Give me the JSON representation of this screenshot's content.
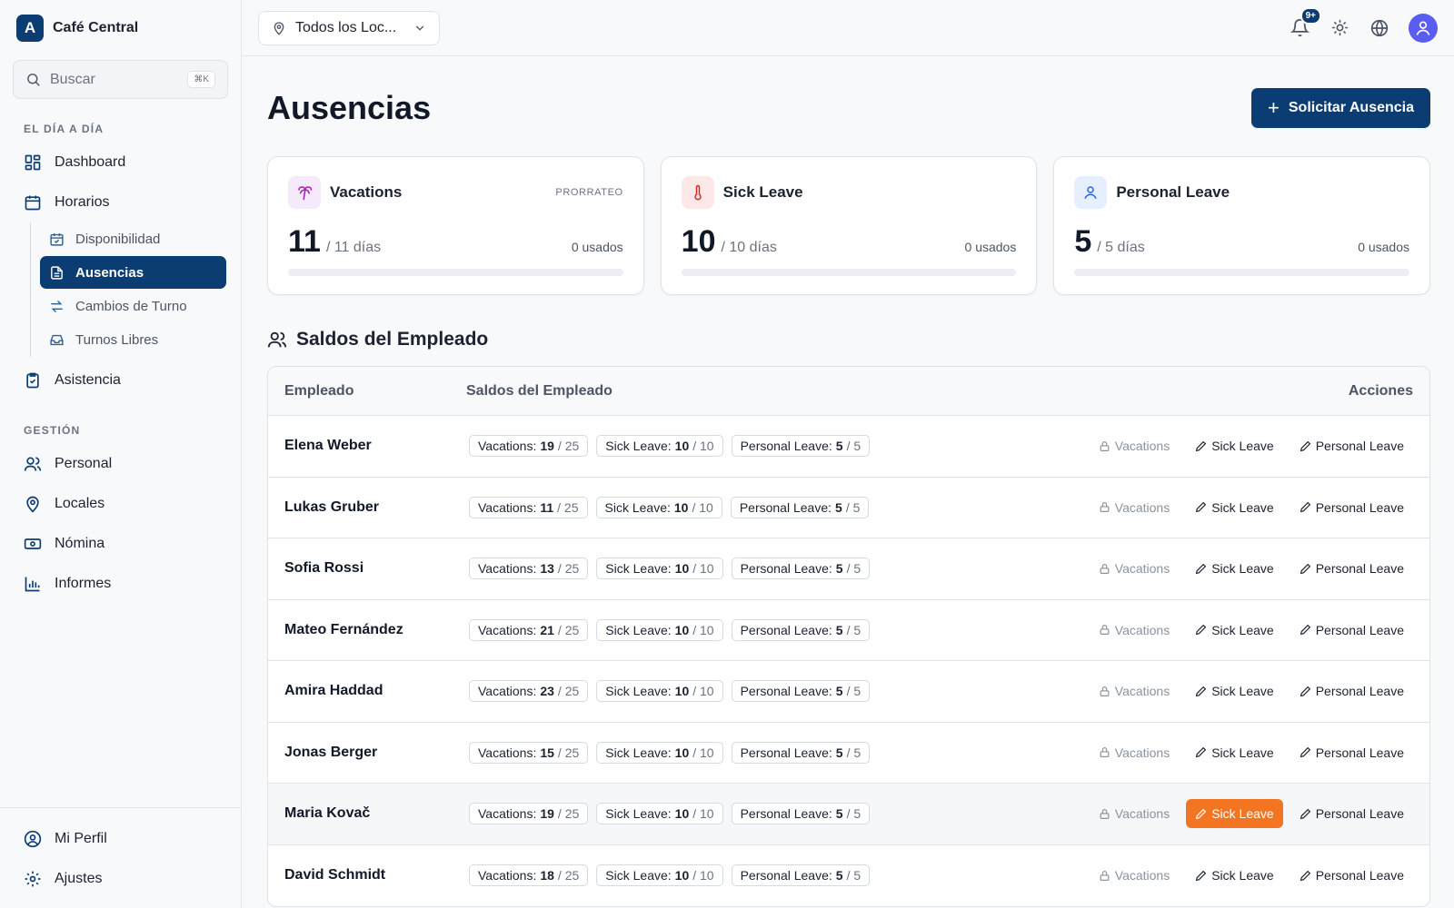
{
  "brand": {
    "initial": "A",
    "name": "Café Central"
  },
  "search": {
    "placeholder": "Buscar",
    "shortcut": "⌘K"
  },
  "sidebar": {
    "section1": "EL DÍA A DÍA",
    "dashboard": "Dashboard",
    "horarios": "Horarios",
    "sub": [
      "Disponibilidad",
      "Ausencias",
      "Cambios de Turno",
      "Turnos Libres"
    ],
    "asistencia": "Asistencia",
    "section2": "GESTIÓN",
    "gestion": [
      "Personal",
      "Locales",
      "Nómina",
      "Informes"
    ],
    "bottom": [
      "Mi Perfil",
      "Ajustes"
    ]
  },
  "topbar": {
    "location": "Todos los Loc...",
    "notif_badge": "9+"
  },
  "page": {
    "title": "Ausencias",
    "request_button": "Solicitar Ausencia"
  },
  "cards": [
    {
      "title": "Vacations",
      "tag": "PRORRATEO",
      "value": "11",
      "total": "/ 11 días",
      "used": "0 usados",
      "used_fraction": 0
    },
    {
      "title": "Sick Leave",
      "tag": "",
      "value": "10",
      "total": "/ 10 días",
      "used": "0 usados",
      "used_fraction": 0
    },
    {
      "title": "Personal Leave",
      "tag": "",
      "value": "5",
      "total": "/ 5 días",
      "used": "0 usados",
      "used_fraction": 0
    }
  ],
  "balances": {
    "title": "Saldos del Empleado",
    "headers": {
      "employee": "Empleado",
      "balances": "Saldos del Empleado",
      "actions": "Acciones"
    },
    "labels": {
      "vac": "Vacations:",
      "sick": "Sick Leave:",
      "pers": "Personal Leave:"
    },
    "actions": {
      "vac": "Vacations",
      "sick": "Sick Leave",
      "pers": "Personal Leave"
    },
    "rows": [
      {
        "name": "Elena Weber",
        "vac": "19",
        "vac_total": "/ 25",
        "sick": "10",
        "sick_total": "/ 10",
        "pers": "5",
        "pers_total": "/ 5"
      },
      {
        "name": "Lukas Gruber",
        "vac": "11",
        "vac_total": "/ 25",
        "sick": "10",
        "sick_total": "/ 10",
        "pers": "5",
        "pers_total": "/ 5"
      },
      {
        "name": "Sofia Rossi",
        "vac": "13",
        "vac_total": "/ 25",
        "sick": "10",
        "sick_total": "/ 10",
        "pers": "5",
        "pers_total": "/ 5"
      },
      {
        "name": "Mateo Fernández",
        "vac": "21",
        "vac_total": "/ 25",
        "sick": "10",
        "sick_total": "/ 10",
        "pers": "5",
        "pers_total": "/ 5"
      },
      {
        "name": "Amira Haddad",
        "vac": "23",
        "vac_total": "/ 25",
        "sick": "10",
        "sick_total": "/ 10",
        "pers": "5",
        "pers_total": "/ 5"
      },
      {
        "name": "Jonas Berger",
        "vac": "15",
        "vac_total": "/ 25",
        "sick": "10",
        "sick_total": "/ 10",
        "pers": "5",
        "pers_total": "/ 5"
      },
      {
        "name": "Maria Kovač",
        "vac": "19",
        "vac_total": "/ 25",
        "sick": "10",
        "sick_total": "/ 10",
        "pers": "5",
        "pers_total": "/ 5"
      },
      {
        "name": "David Schmidt",
        "vac": "18",
        "vac_total": "/ 25",
        "sick": "10",
        "sick_total": "/ 10",
        "pers": "5",
        "pers_total": "/ 5"
      }
    ]
  },
  "colors": {
    "primary": "#0b3d73",
    "accent_orange": "#f47521",
    "vacations_icon": "#a21caf",
    "sick_icon": "#dc2626",
    "personal_icon": "#2563eb"
  }
}
